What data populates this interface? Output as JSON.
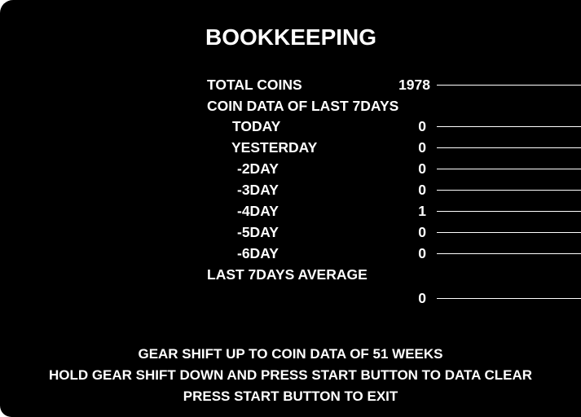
{
  "title": "BOOKKEEPING",
  "total_coins": {
    "label": "TOTAL COINS",
    "value": "1978"
  },
  "section_heading": "COIN DATA OF LAST 7DAYS",
  "days": [
    {
      "label": "TODAY",
      "value": "0"
    },
    {
      "label": "YESTERDAY",
      "value": "0"
    },
    {
      "label": "-2DAY",
      "value": "0"
    },
    {
      "label": "-3DAY",
      "value": "0"
    },
    {
      "label": "-4DAY",
      "value": "1"
    },
    {
      "label": "-5DAY",
      "value": "0"
    },
    {
      "label": "-6DAY",
      "value": "0"
    }
  ],
  "average": {
    "label": "LAST 7DAYS AVERAGE",
    "value": "0"
  },
  "instructions": [
    "GEAR SHIFT UP TO COIN DATA OF 51 WEEKS",
    "HOLD GEAR SHIFT DOWN AND PRESS START BUTTON TO DATA CLEAR",
    "PRESS START BUTTON TO EXIT"
  ],
  "colors": {
    "background": "#000000",
    "text": "#ffffff"
  }
}
